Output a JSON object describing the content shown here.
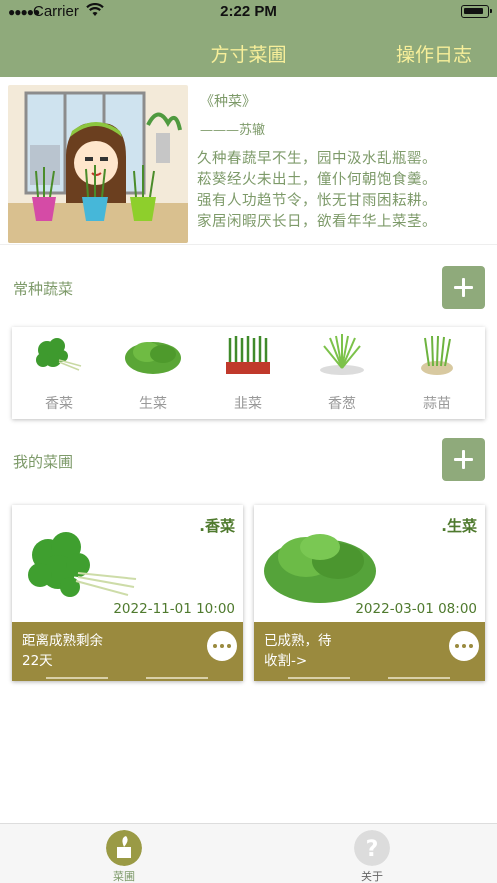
{
  "status_bar": {
    "carrier": "Carrier",
    "time": "2:22 PM"
  },
  "nav": {
    "title": "方寸菜圃",
    "right_action": "操作日志"
  },
  "poem": {
    "title": "《种菜》",
    "author": "———苏辙",
    "lines": [
      "久种春蔬早不生，园中汲水乱瓶罂。",
      "菘葵经火未出土，僮仆何朝饱食羹。",
      "强有人功趋节令，怅无甘雨困耘耕。",
      "家居闲暇厌长日，欲看年华上菜茎。"
    ]
  },
  "common_section": {
    "title": "常种蔬菜",
    "items": [
      {
        "label": "香菜",
        "icon": "coriander-icon"
      },
      {
        "label": "生菜",
        "icon": "lettuce-icon"
      },
      {
        "label": "韭菜",
        "icon": "chives-icon"
      },
      {
        "label": "香葱",
        "icon": "scallion-icon"
      },
      {
        "label": "蒜苗",
        "icon": "garlic-sprout-icon"
      }
    ]
  },
  "garden_section": {
    "title": "我的菜圃",
    "cards": [
      {
        "name": ".香菜",
        "date": "2022-11-01 10:00",
        "status_line1": "距离成熟剩余",
        "status_line2": "22天"
      },
      {
        "name": ".生菜",
        "date": "2022-03-01 08:00",
        "status_line1": "已成熟，待",
        "status_line2": "收割->"
      }
    ]
  },
  "tabbar": {
    "tabs": [
      {
        "label": "菜圃",
        "active": true
      },
      {
        "label": "关于",
        "active": false
      }
    ]
  },
  "colors": {
    "header": "#8faa7b",
    "title_yellow": "#f7ef9a",
    "section_green": "#7d9a69",
    "card_footer": "#9a8a3e",
    "card_text_green": "#4f7a2e"
  }
}
